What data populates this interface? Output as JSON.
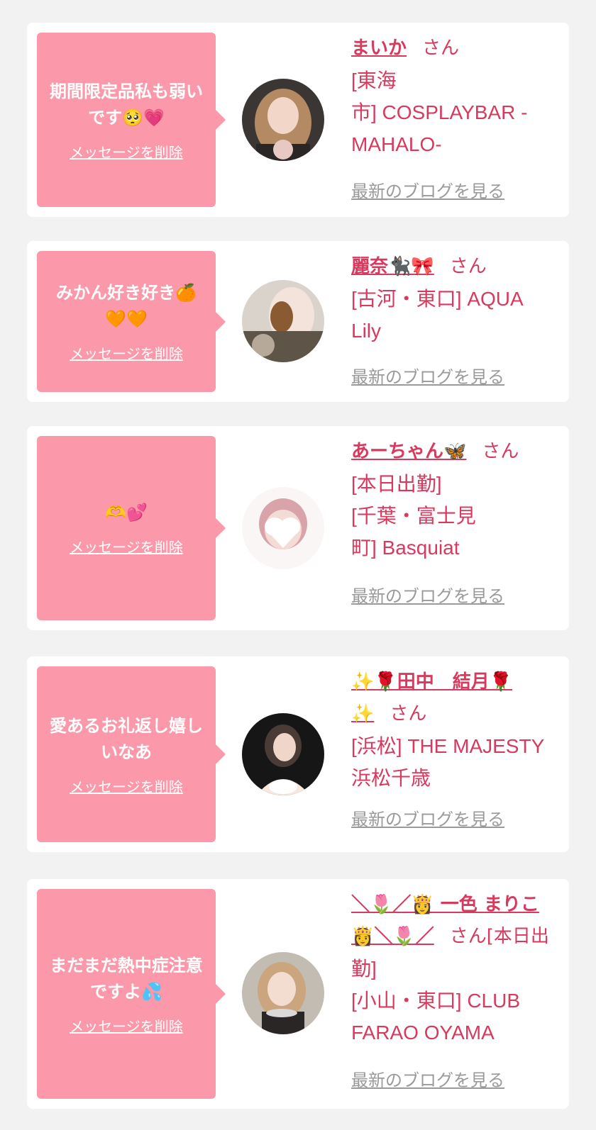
{
  "delete_label": "メッセージを削除",
  "blog_label": "最新のブログを見る",
  "san_label": "さん",
  "cards": [
    {
      "message": "期間限定品私も弱いです",
      "message_emoji": "🥺💗",
      "name": "まいか",
      "shop_lines": [
        "[東海",
        "市] COSPLAYBAR -",
        "MAHALO-"
      ]
    },
    {
      "message": "みかん好き好き",
      "message_emoji": "🍊🧡🧡",
      "name": "麗奈",
      "name_emoji": "🐈‍⬛🎀",
      "shop_lines": [
        "[古河・東口] AQUA",
        "Lily"
      ]
    },
    {
      "message": "",
      "message_emoji": "🫶💕",
      "name": "あーちゃん",
      "name_emoji": "🦋",
      "shop_lines": [
        "[本日出勤]",
        "[千葉・富士見",
        "町] Basquiat"
      ]
    },
    {
      "message": "愛あるお礼返し嬉しいなあ",
      "message_emoji": "",
      "name_line1": "✨🌹田中　結月🌹",
      "name_line2": "✨",
      "shop_lines": [
        "[浜松] THE MAJESTY",
        "浜松千歳"
      ]
    },
    {
      "message": "まだまだ熱中症注意ですよ",
      "message_emoji": "💦",
      "name_line1": "＼🌷／👸 一色 まりこ",
      "name_line2": "👸＼🌷／",
      "name_suffix": "[本日出",
      "shop_lines": [
        "勤]",
        "[小山・東口] CLUB",
        "FARAO OYAMA"
      ]
    }
  ]
}
